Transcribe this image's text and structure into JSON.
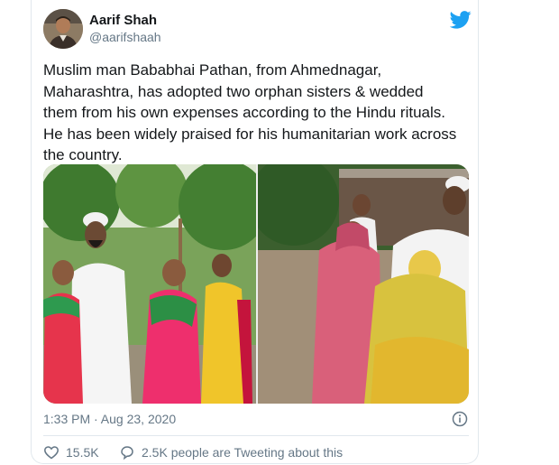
{
  "author": {
    "name": "Aarif Shah",
    "handle": "@aarifshaah",
    "avatar_icon": "person-avatar"
  },
  "tweet": {
    "text": "Muslim man Bababhai Pathan, from Ahmednagar,\nMaharashtra, has adopted two orphan sisters & wedded\nthem from his own expenses according to the Hindu rituals.\nHe has been widely praised for his humanitarian work across\nthe country."
  },
  "media": {
    "photo_count": 2
  },
  "meta": {
    "timestamp": "1:33 PM · Aug 23, 2020"
  },
  "engagement": {
    "likes": "15.5K",
    "tweeting": "2.5K people are Tweeting about this"
  },
  "colors": {
    "twitter_blue": "#1da1f2",
    "secondary_text": "#657786",
    "border": "#e1e8ed"
  }
}
